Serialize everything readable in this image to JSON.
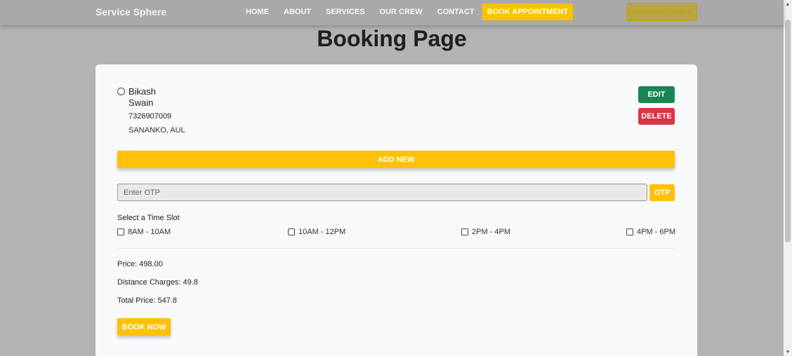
{
  "navbar": {
    "brand": "Service Sphere",
    "links": [
      {
        "label": "HOME"
      },
      {
        "label": "ABOUT"
      },
      {
        "label": "SERVICES"
      },
      {
        "label": "OUR CREW"
      },
      {
        "label": "CONTACT"
      },
      {
        "label": "BOOK APPOINTMENT"
      }
    ],
    "welcome_label": "Welcome, Kajal"
  },
  "page": {
    "title": "Booking Page"
  },
  "address": {
    "first_name": "Bikash",
    "last_name": "Swain",
    "phone": "7326907009",
    "city": "SANANKO, AUL",
    "edit_label": "EDIT",
    "delete_label": "DELETE"
  },
  "add_new_label": "ADD NEW",
  "otp": {
    "placeholder": "Enter OTP",
    "button_label": "OTP"
  },
  "time_slots": {
    "label": "Select a Time Slot",
    "options": [
      "8AM - 10AM",
      "10AM - 12PM",
      "2PM - 4PM",
      "4PM - 6PM"
    ]
  },
  "pricing": {
    "price": "Price: 498.00",
    "distance": "Distance Charges: 49.8",
    "total": "Total Price: 547.8"
  },
  "book_now_label": "BOOK NOW",
  "icons": {
    "caret": "chevron-down-icon",
    "scroll_up": "arrow-up-icon",
    "scroll_down": "arrow-down-icon"
  },
  "colors": {
    "accent": "#ffc107",
    "edit": "#198754",
    "delete": "#dc3545"
  }
}
